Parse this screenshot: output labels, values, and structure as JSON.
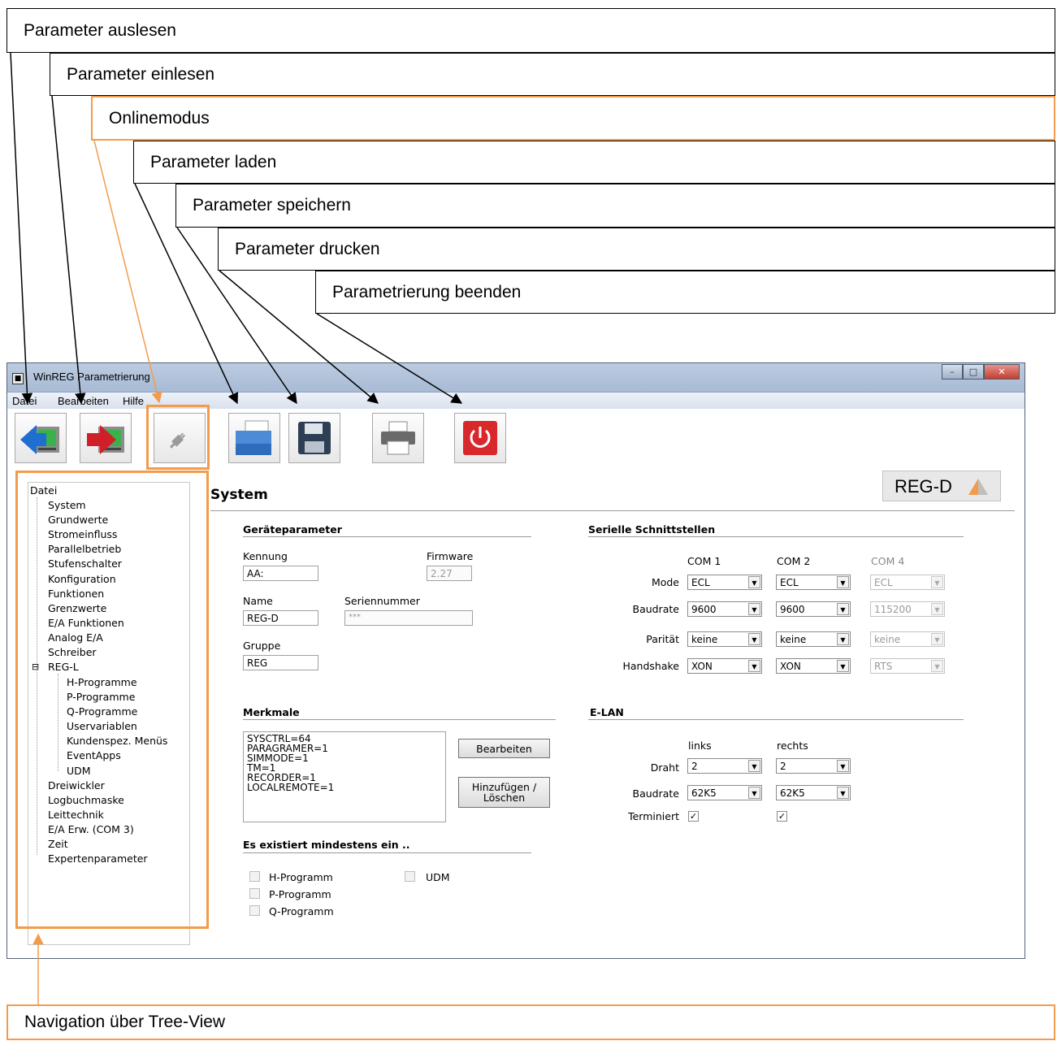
{
  "callouts": {
    "read_params": "Parameter auslesen",
    "load_in_params": "Parameter einlesen",
    "online_mode": "Onlinemodus",
    "load_params": "Parameter laden",
    "save_params": "Parameter speichern",
    "print_params": "Parameter drucken",
    "exit_params": "Parametrierung beenden",
    "tree_nav": "Navigation über Tree-View"
  },
  "window": {
    "title": "WinREG Parametrierung"
  },
  "menu": {
    "file": "Datei",
    "edit": "Bearbeiten",
    "help": "Hilfe"
  },
  "icons": {
    "read": "arrow-left-device-icon",
    "write": "arrow-right-device-icon",
    "online": "plug-icon",
    "open": "folder-icon",
    "save": "floppy-disk-icon",
    "print": "printer-icon",
    "exit": "power-icon"
  },
  "tree": {
    "root": "Datei",
    "items": [
      "System",
      "Grundwerte",
      "Stromeinfluss",
      "Parallelbetrieb",
      "Stufenschalter",
      "Konfiguration",
      "Funktionen",
      "Grenzwerte",
      "E/A Funktionen",
      "Analog E/A",
      "Schreiber"
    ],
    "regl": "REG-L",
    "regl_expander": "⊟",
    "regl_children": [
      "H-Programme",
      "P-Programme",
      "Q-Programme",
      "Uservariablen",
      "Kundenspez. Menüs",
      "EventApps",
      "UDM"
    ],
    "items2": [
      "Dreiwickler",
      "Logbuchmaske",
      "Leittechnik",
      "E/A Erw. (COM 3)",
      "Zeit",
      "Expertenparameter"
    ]
  },
  "logo": "REG-D",
  "page_title": "System",
  "device_params": {
    "header": "Geräteparameter",
    "kennung_label": "Kennung",
    "kennung": "AA:",
    "firmware_label": "Firmware",
    "firmware": "2.27",
    "name_label": "Name",
    "name": "REG-D",
    "serial_label": "Seriennummer",
    "serial": "***",
    "group_label": "Gruppe",
    "group": "REG"
  },
  "serial_ports": {
    "header": "Serielle Schnittstellen",
    "columns": [
      "COM 1",
      "COM 2",
      "COM 4"
    ],
    "row_labels": [
      "Mode",
      "Baudrate",
      "Parität",
      "Handshake"
    ],
    "com1": [
      "ECL",
      "9600",
      "keine",
      "XON"
    ],
    "com2": [
      "ECL",
      "9600",
      "keine",
      "XON"
    ],
    "com4": [
      "ECL",
      "115200",
      "keine",
      "RTS"
    ]
  },
  "features": {
    "header": "Merkmale",
    "lines": [
      "SYSCTRL=64",
      "PARAGRAMER=1",
      "SIMMODE=1",
      "TM=1",
      "RECORDER=1",
      "LOCALREMOTE=1"
    ],
    "edit_button": "Bearbeiten",
    "add_button_line1": "Hinzufügen /",
    "add_button_line2": "Löschen"
  },
  "elan": {
    "header": "E-LAN",
    "left_label": "links",
    "right_label": "rechts",
    "wire_label": "Draht",
    "baud_label": "Baudrate",
    "term_label": "Terminiert",
    "wire_left": "2",
    "wire_right": "2",
    "baud_left": "62K5",
    "baud_right": "62K5",
    "term_left": "✓",
    "term_right": "✓"
  },
  "exists": {
    "header": "Es existiert mindestens ein ..",
    "h_prog": "H-Programm",
    "p_prog": "P-Programm",
    "q_prog": "Q-Programm",
    "udm": "UDM"
  },
  "colors": {
    "accent_orange": "#f39b4c",
    "exit_red": "#d9282c",
    "read_blue": "#1f6fd1",
    "write_red": "#d11f2a"
  }
}
